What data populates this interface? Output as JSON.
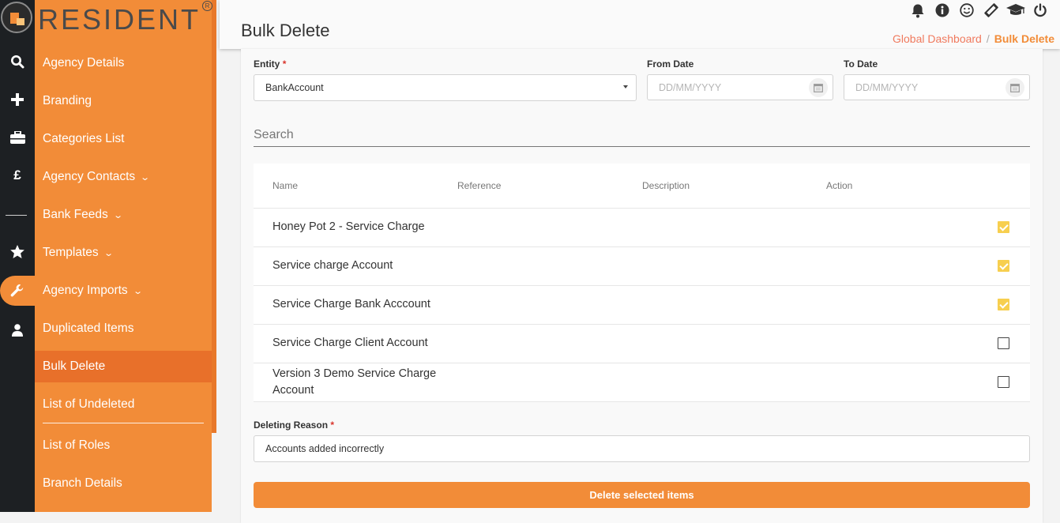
{
  "brand": {
    "name": "RESIDENT",
    "reg": "R"
  },
  "rail": {
    "icons": [
      "search-icon",
      "plus-icon",
      "briefcase-icon",
      "pound-icon",
      "separator",
      "star-icon",
      "wrench-icon",
      "user-icon"
    ],
    "pound_symbol": "£",
    "active_index": 6
  },
  "menu": {
    "items": [
      {
        "label": "Agency Details",
        "has_children": false
      },
      {
        "label": "Branding",
        "has_children": false
      },
      {
        "label": "Categories List",
        "has_children": false
      },
      {
        "label": "Agency Contacts",
        "has_children": true
      },
      {
        "label": "Bank Feeds",
        "has_children": true
      },
      {
        "label": "Templates",
        "has_children": true
      },
      {
        "label": "Agency Imports",
        "has_children": true
      },
      {
        "label": "Duplicated Items",
        "has_children": false
      },
      {
        "label": "Bulk Delete",
        "has_children": false,
        "active": true
      },
      {
        "label": "List of Undeleted",
        "has_children": false
      },
      {
        "label": "List of Roles",
        "has_children": false
      },
      {
        "label": "Branch Details",
        "has_children": false
      }
    ],
    "chevron": "⌄"
  },
  "header": {
    "title": "Bulk Delete",
    "breadcrumb": {
      "link": "Global Dashboard",
      "separator": "/",
      "current": "Bulk Delete"
    },
    "icons": [
      "bell-icon",
      "info-icon",
      "smiley-icon",
      "ticket-icon",
      "graduation-cap-icon",
      "power-icon"
    ]
  },
  "form": {
    "entity": {
      "label": "Entity",
      "required_mark": "*",
      "value": "BankAccount"
    },
    "from_date": {
      "label": "From Date",
      "placeholder": "DD/MM/YYYY"
    },
    "to_date": {
      "label": "To Date",
      "placeholder": "DD/MM/YYYY"
    },
    "search": {
      "placeholder": "Search"
    },
    "reason": {
      "label": "Deleting Reason",
      "required_mark": "*",
      "value": "Accounts added incorrectly"
    },
    "delete_button": "Delete selected items"
  },
  "table": {
    "columns": [
      "Name",
      "Reference",
      "Description",
      "Action"
    ],
    "rows": [
      {
        "name": "Honey Pot 2 - Service Charge",
        "selected": true
      },
      {
        "name": "Service charge Account",
        "selected": true
      },
      {
        "name": "Service Charge Bank Acccount",
        "selected": true
      },
      {
        "name": "Service Charge Client Account",
        "selected": false
      },
      {
        "name": "Version 3 Demo Service Charge Account",
        "selected": false
      }
    ]
  },
  "colors": {
    "accent": "#f28c38",
    "rail": "#1d2023",
    "checked": "#f7cf4f",
    "crumb_link": "#f07a5e"
  }
}
